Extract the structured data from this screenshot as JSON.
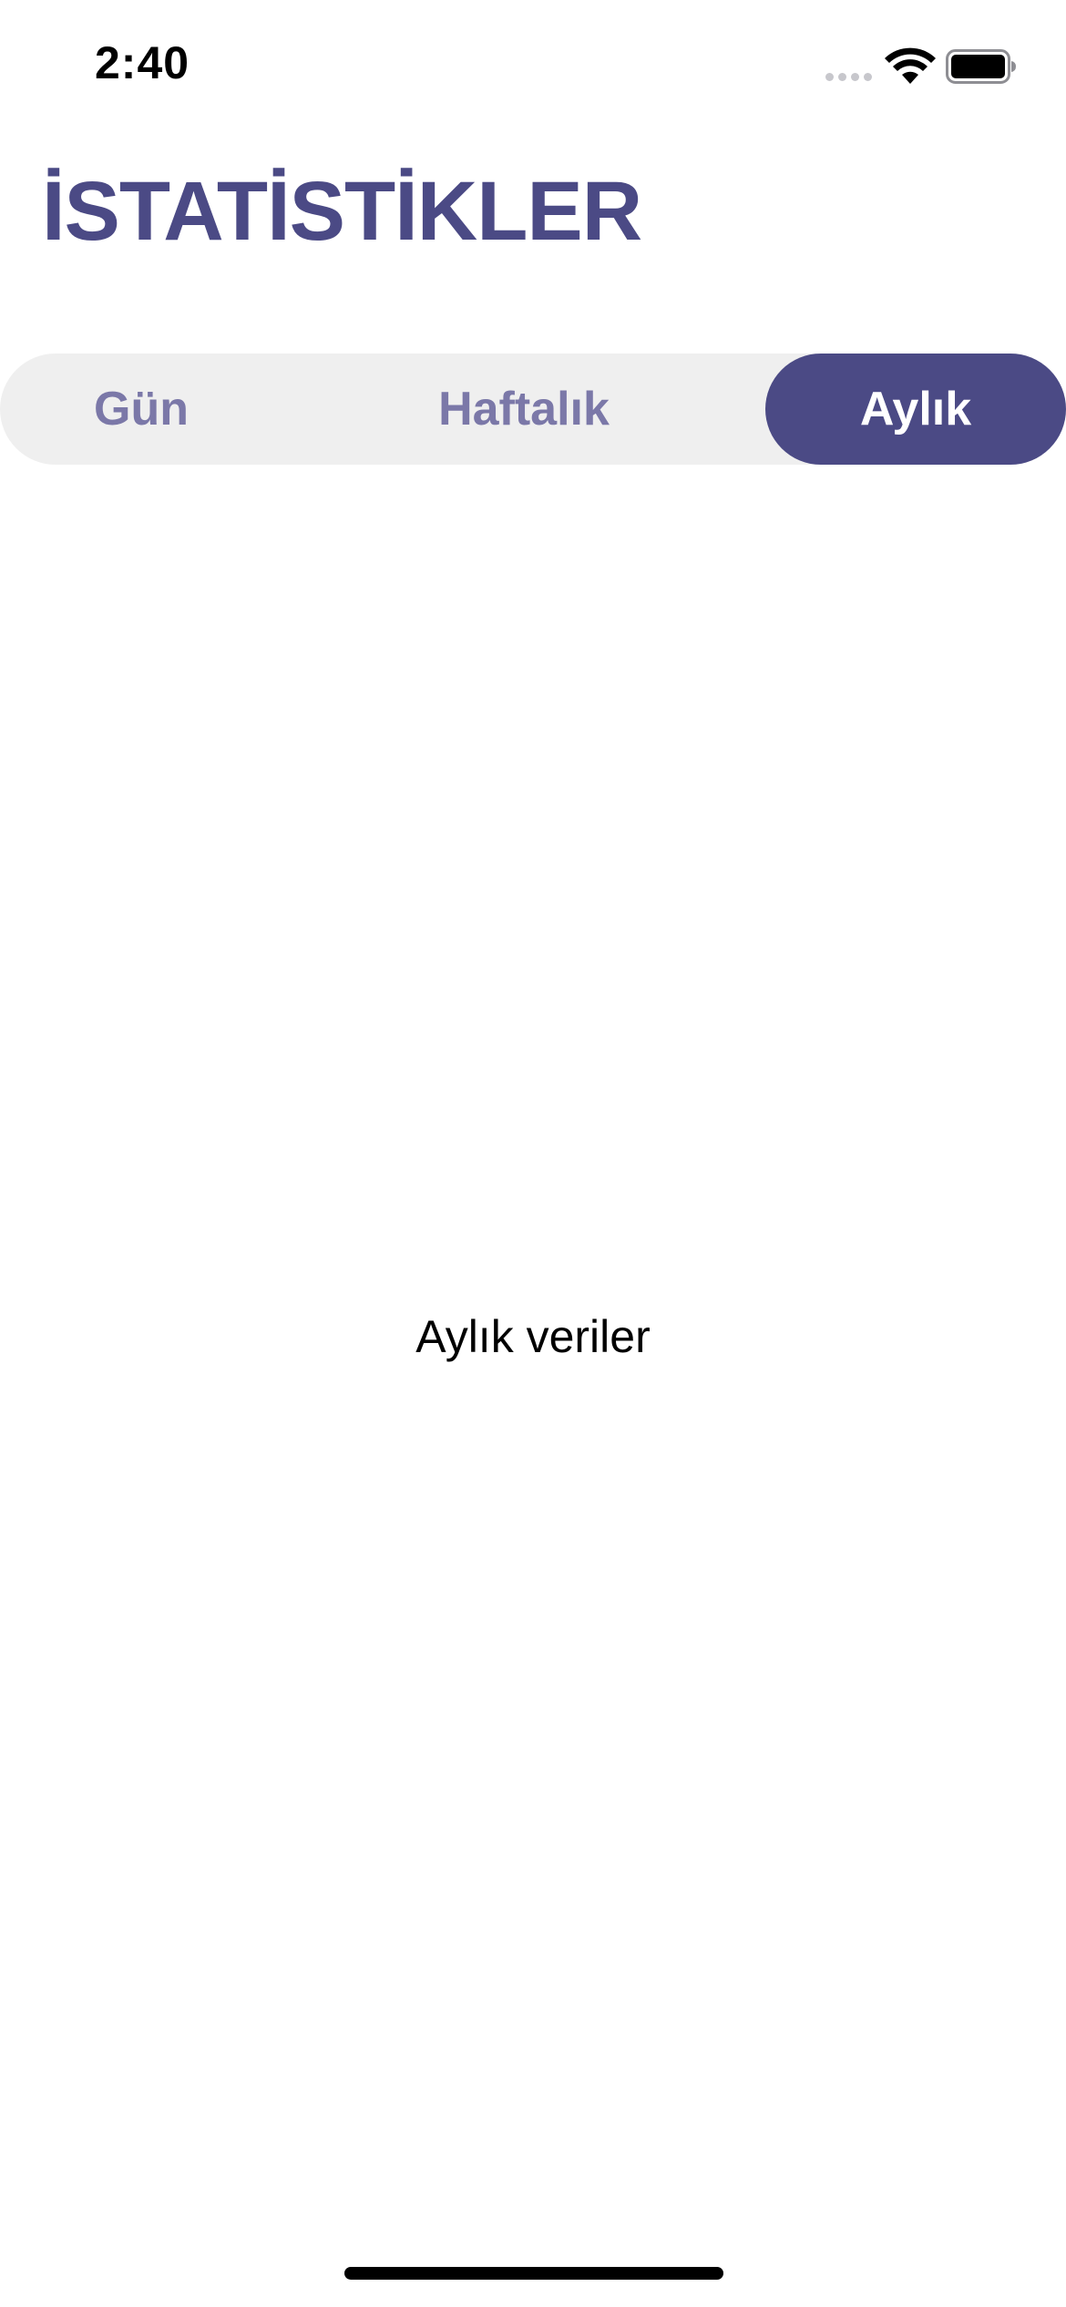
{
  "status_bar": {
    "time": "2:40",
    "icons": [
      "signal-dots-icon",
      "wifi-icon",
      "battery-icon"
    ]
  },
  "header": {
    "title": "İSTATİSTİKLER"
  },
  "segmented_control": {
    "items": [
      {
        "label": "Gün",
        "selected": false
      },
      {
        "label": "Haftalık",
        "selected": false
      },
      {
        "label": "Aylık",
        "selected": true
      }
    ]
  },
  "content": {
    "text": "Aylık veriler"
  },
  "colors": {
    "accent": "#4b4a85",
    "inactive_label": "#7b78a8",
    "segment_background": "#efefef",
    "background": "#ffffff"
  }
}
